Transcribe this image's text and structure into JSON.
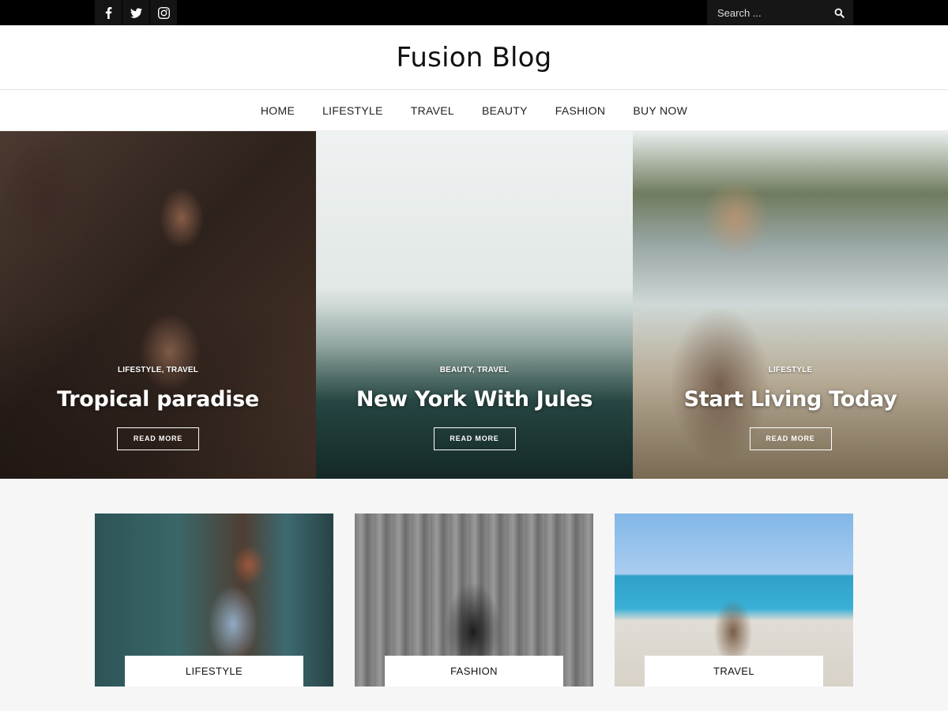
{
  "topbar": {
    "social": [
      {
        "icon": "facebook-icon"
      },
      {
        "icon": "twitter-icon"
      },
      {
        "icon": "instagram-icon"
      }
    ],
    "search": {
      "placeholder": "Search ...",
      "icon": "search-icon"
    }
  },
  "header": {
    "site_title": "Fusion Blog"
  },
  "nav": {
    "items": [
      {
        "label": "HOME"
      },
      {
        "label": "LIFESTYLE"
      },
      {
        "label": "TRAVEL"
      },
      {
        "label": "BEAUTY"
      },
      {
        "label": "FASHION"
      },
      {
        "label": "BUY NOW"
      }
    ]
  },
  "slider": {
    "slides": [
      {
        "categories": "LIFESTYLE, TRAVEL",
        "title": "Tropical paradise",
        "button": "READ MORE"
      },
      {
        "categories": "BEAUTY, TRAVEL",
        "title": "New York With Jules",
        "button": "READ MORE"
      },
      {
        "categories": "LIFESTYLE",
        "title": "Start Living Today",
        "button": "READ MORE"
      }
    ]
  },
  "featured": {
    "cards": [
      {
        "label": "LIFESTYLE"
      },
      {
        "label": "FASHION"
      },
      {
        "label": "TRAVEL"
      }
    ]
  },
  "colors": {
    "topbar_bg": "#000000",
    "featured_bg": "#f6f6f6",
    "text": "#222222"
  }
}
